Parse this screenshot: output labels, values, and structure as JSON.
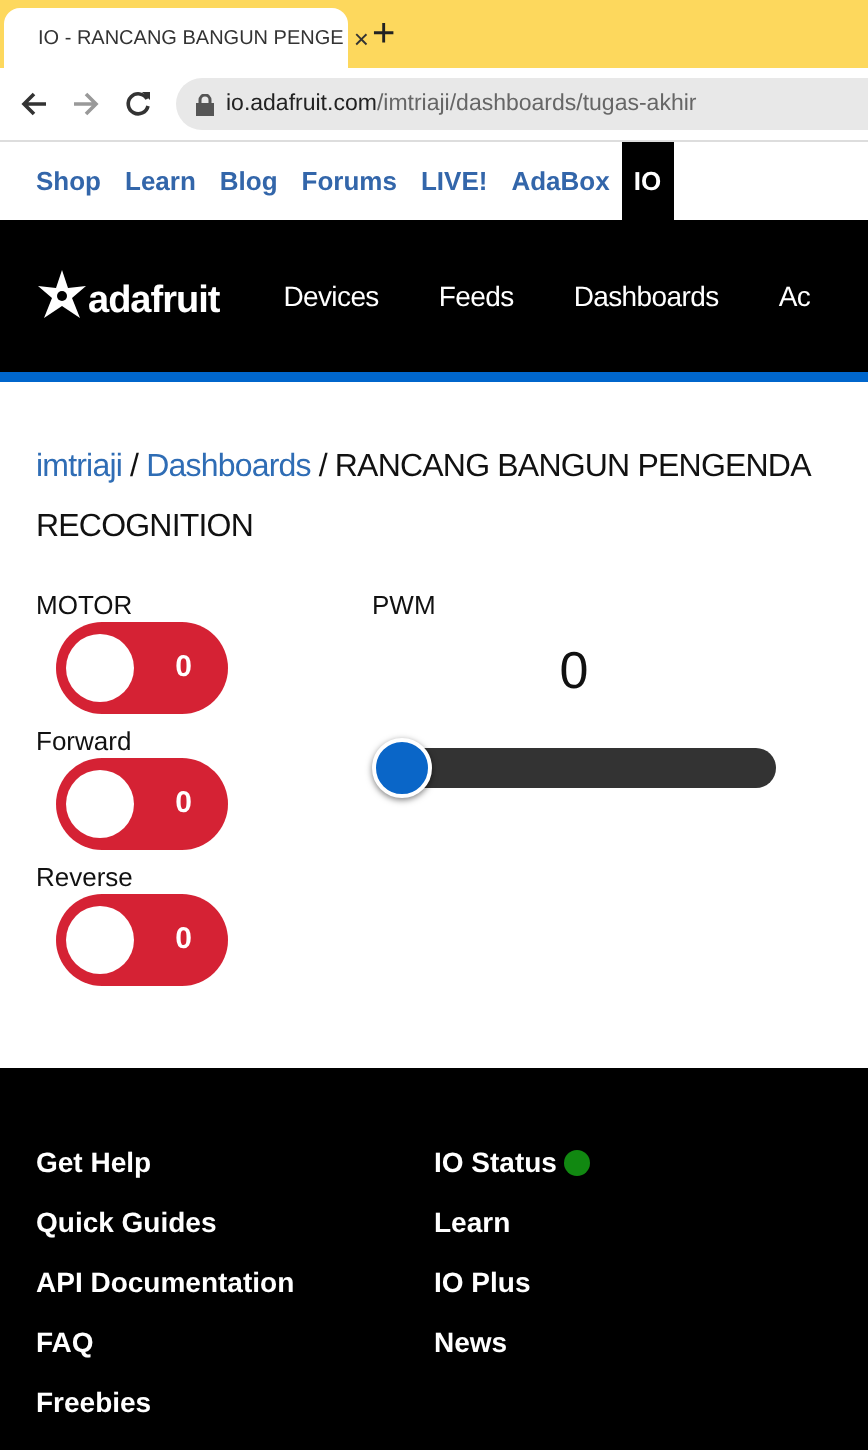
{
  "browser": {
    "tab": {
      "title": "IO - RANCANG BANGUN PENGE",
      "close": "×"
    },
    "new_tab": "+",
    "address": {
      "domain": "io.adafruit.com",
      "path": "/imtriaji/dashboards/tugas-akhir"
    }
  },
  "top_links": [
    {
      "label": "Shop",
      "selected": false
    },
    {
      "label": "Learn",
      "selected": false
    },
    {
      "label": "Blog",
      "selected": false
    },
    {
      "label": "Forums",
      "selected": false
    },
    {
      "label": "LIVE!",
      "selected": false
    },
    {
      "label": "AdaBox",
      "selected": false
    },
    {
      "label": "IO",
      "selected": true
    }
  ],
  "nav": {
    "logo": "adafruit",
    "items": [
      "Devices",
      "Feeds",
      "Dashboards",
      "Ac"
    ]
  },
  "breadcrumb": {
    "user": "imtriaji",
    "section": "Dashboards",
    "separator": "/",
    "title_lines": [
      "RANCANG BANGUN PENGENDA",
      "RECOGNITION"
    ]
  },
  "toggles": [
    {
      "label": "MOTOR",
      "value": "0",
      "on": false
    },
    {
      "label": "Forward",
      "value": "0",
      "on": false
    },
    {
      "label": "Reverse",
      "value": "0",
      "on": false
    }
  ],
  "slider": {
    "label": "PWM",
    "reading": "0",
    "level": 0
  },
  "footer": {
    "columns": [
      [
        {
          "label": "Get Help"
        },
        {
          "label": "Quick Guides"
        },
        {
          "label": "API Documentation"
        },
        {
          "label": "FAQ"
        },
        {
          "label": "Freebies"
        }
      ],
      [
        {
          "label": "IO Status",
          "color": "#118811"
        },
        {
          "label": "Learn"
        },
        {
          "label": "IO Plus"
        },
        {
          "label": "News"
        }
      ]
    ]
  }
}
